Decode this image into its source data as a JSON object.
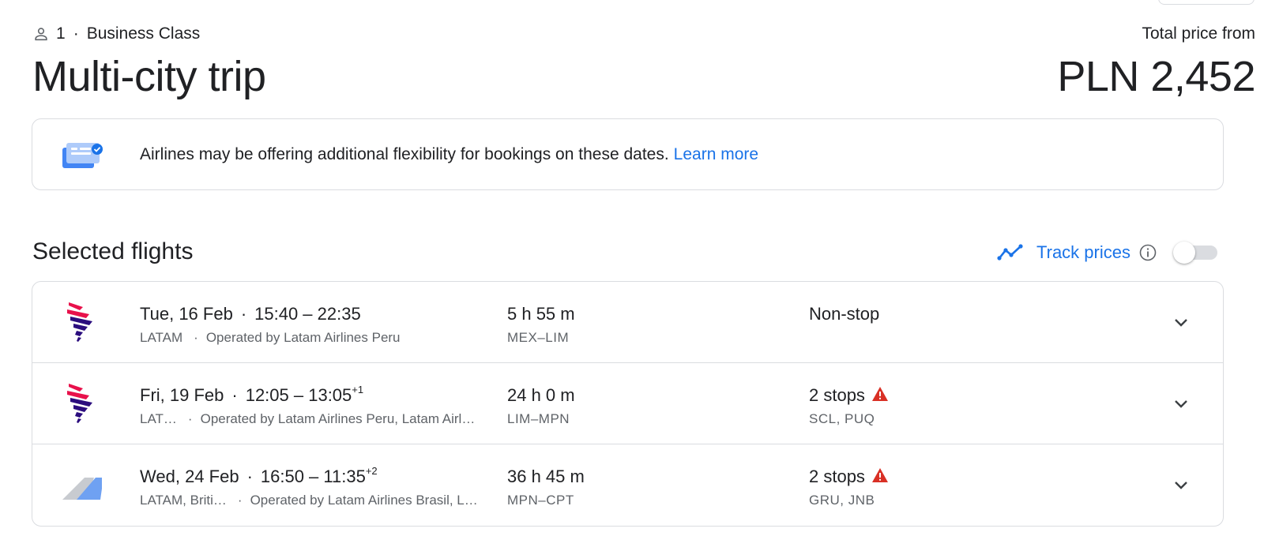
{
  "header": {
    "passengers": "1",
    "separator": "·",
    "cabin": "Business Class",
    "title": "Multi-city trip",
    "price_label": "Total price from",
    "price": "PLN 2,452"
  },
  "banner": {
    "message": "Airlines may be offering additional flexibility for bookings on these dates.",
    "link": "Learn more",
    "icon": "ticket-check-icon"
  },
  "section": {
    "title": "Selected flights"
  },
  "track_prices": {
    "label": "Track prices",
    "enabled": false
  },
  "colors": {
    "accent": "#1a73e8",
    "warning": "#d93025",
    "latam_red": "#e8114b",
    "latam_navy": "#2b0d7e",
    "tail_blue": "#6fa1f2"
  },
  "flights": [
    {
      "date": "Tue, 16 Feb",
      "times": "15:40 – 22:35",
      "day_offset": "",
      "carrier": "LATAM",
      "operated": "Operated by Latam Airlines Peru",
      "duration": "5 h 55 m",
      "route": "MEX–LIM",
      "stops": "Non-stop",
      "stop_codes": "",
      "warning": false,
      "logo": "latam-logo"
    },
    {
      "date": "Fri, 19 Feb",
      "times": "12:05 – 13:05",
      "day_offset": "+1",
      "carrier": "LAT…",
      "operated": "Operated by Latam Airlines Peru, Latam Airl…",
      "duration": "24 h 0 m",
      "route": "LIM–MPN",
      "stops": "2 stops",
      "stop_codes": "SCL, PUQ",
      "warning": true,
      "logo": "latam-logo"
    },
    {
      "date": "Wed, 24 Feb",
      "times": "16:50 – 11:35",
      "day_offset": "+2",
      "carrier": "LATAM, Briti…",
      "operated": "Operated by Latam Airlines Brasil, L…",
      "duration": "36 h 45 m",
      "route": "MPN–CPT",
      "stops": "2 stops",
      "stop_codes": "GRU, JNB",
      "warning": true,
      "logo": "multi-airline-tail-logo"
    }
  ]
}
